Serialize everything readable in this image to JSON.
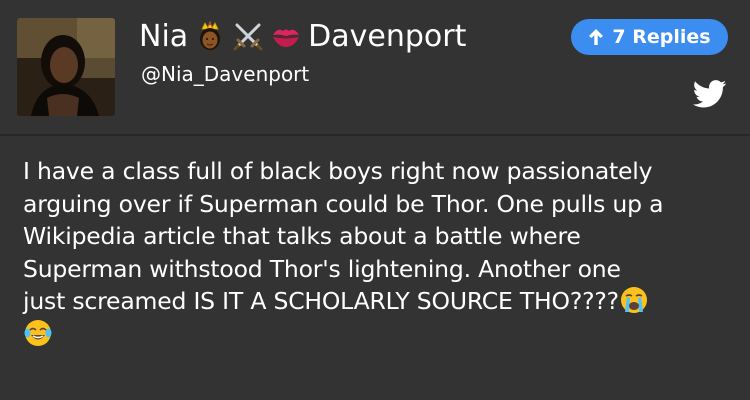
{
  "profile": {
    "name_first": "Nia",
    "name_last": "Davenport",
    "handle": "@Nia_Davenport",
    "name_emoji_icons": [
      "princess-emoji-icon",
      "crossed-swords-icon",
      "kiss-mark-icon"
    ]
  },
  "replies_button": {
    "icon": "arrow-up-icon",
    "label": "7 Replies",
    "color": "#3b8df0"
  },
  "brand_icon": "twitter-bird-icon",
  "tweet": {
    "lines": [
      "I have a class full of black boys right now passionately",
      "arguing over if Superman could be Thor. One pulls up a",
      "Wikipedia article that talks about a battle where",
      "Superman withstood Thor's lightening. Another one",
      "just screamed IS IT A SCHOLARLY SOURCE THO????"
    ],
    "trailing_emoji_icons": [
      "loudly-crying-face-icon",
      "face-with-tears-of-joy-icon"
    ]
  },
  "colors": {
    "background": "#333333",
    "text": "#ffffff",
    "accent": "#3b8df0"
  }
}
